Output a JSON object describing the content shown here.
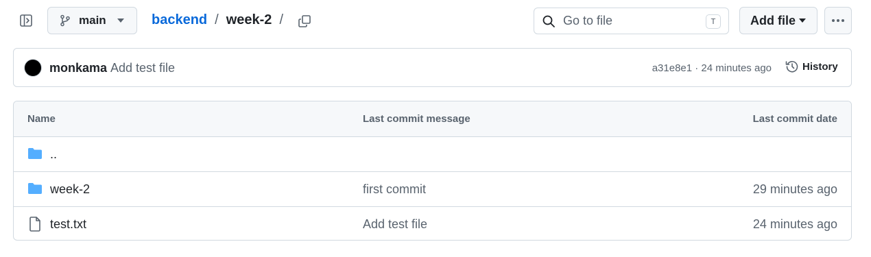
{
  "toolbar": {
    "branch_label": "main",
    "search_placeholder": "Go to file",
    "search_shortcut": "T",
    "add_file_label": "Add file"
  },
  "breadcrumb": {
    "repo": "backend",
    "separator": "/",
    "current": "week-2",
    "trailing_separator": "/"
  },
  "latest_commit": {
    "author": "monkama",
    "message": "Add test file",
    "meta": "a31e8e1 · 24 minutes ago",
    "history_label": "History"
  },
  "file_table": {
    "columns": {
      "name": "Name",
      "message": "Last commit message",
      "date": "Last commit date"
    },
    "rows": [
      {
        "type": "parent-directory",
        "name": "..",
        "message": "",
        "date": ""
      },
      {
        "type": "folder",
        "name": "week-2",
        "message": "first commit",
        "date": "29 minutes ago"
      },
      {
        "type": "file",
        "name": "test.txt",
        "message": "Add test file",
        "date": "24 minutes ago"
      }
    ]
  },
  "colors": {
    "link": "#0969da",
    "folder_icon": "#54aeff",
    "muted_text": "#59636e",
    "border": "#d1d9e0",
    "header_bg": "#f6f8fa"
  },
  "icons": {
    "sidebar_toggle": "sidebar-expand-icon",
    "branch": "git-branch-icon",
    "branch_caret": "triangle-down-icon",
    "copy_path": "copy-icon",
    "search": "search-icon",
    "add_file_caret": "triangle-down-icon",
    "more": "kebab-horizontal-icon",
    "history": "history-icon",
    "folder": "folder-icon",
    "file": "file-icon"
  }
}
